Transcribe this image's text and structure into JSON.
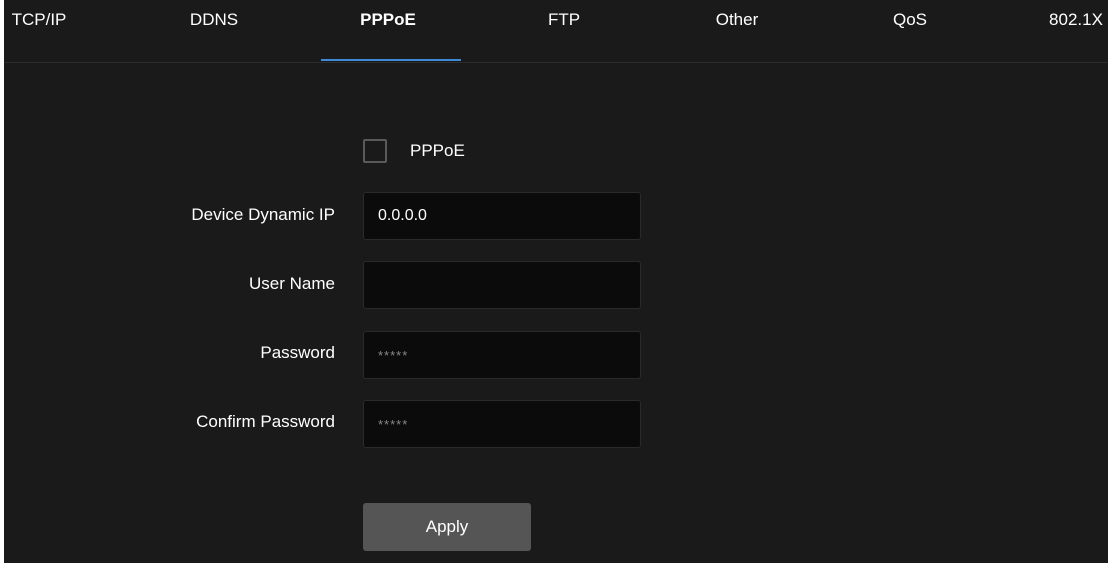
{
  "tabs": [
    {
      "label": "TCP/IP",
      "active": false
    },
    {
      "label": "DDNS",
      "active": false
    },
    {
      "label": "PPPoE",
      "active": true
    },
    {
      "label": "FTP",
      "active": false
    },
    {
      "label": "Other",
      "active": false
    },
    {
      "label": "QoS",
      "active": false
    },
    {
      "label": "802.1X",
      "active": false
    }
  ],
  "pppoe": {
    "enable_label": "PPPoE",
    "enabled": false
  },
  "form": {
    "device_ip_label": "Device Dynamic IP",
    "device_ip_value": "0.0.0.0",
    "username_label": "User Name",
    "username_value": "",
    "password_label": "Password",
    "password_value": "*****",
    "confirm_label": "Confirm Password",
    "confirm_value": "*****"
  },
  "actions": {
    "apply_label": "Apply"
  },
  "colors": {
    "background": "#1a1a1a",
    "input_background": "#0b0b0b",
    "active_tab_underline": "#3d8bd4",
    "button": "#555555"
  }
}
